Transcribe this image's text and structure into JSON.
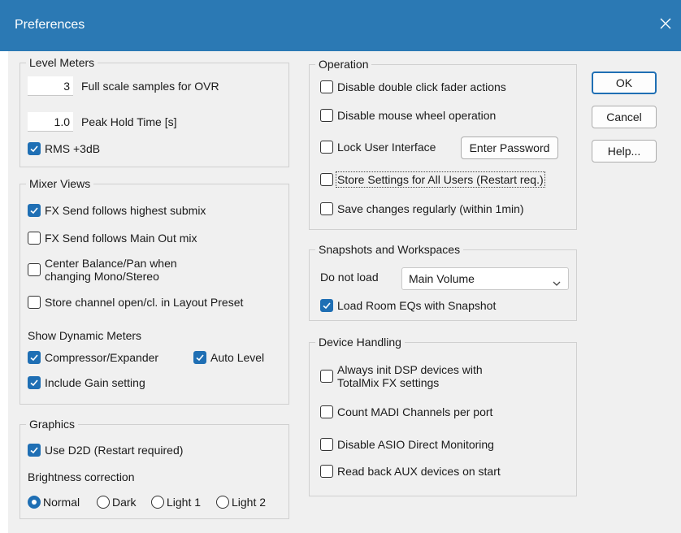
{
  "window": {
    "title": "Preferences",
    "close_icon": "close-icon"
  },
  "level_meters": {
    "legend": "Level Meters",
    "ovr_value": "3",
    "ovr_label": "Full scale samples for OVR",
    "peak_value": "1.0",
    "peak_label": "Peak Hold Time [s]",
    "rms_label": "RMS +3dB"
  },
  "mixer_views": {
    "legend": "Mixer Views",
    "fx_highest": "FX Send follows highest submix",
    "fx_main": "FX Send follows Main Out mix",
    "center_line1": "Center Balance/Pan when",
    "center_line2": "changing Mono/Stereo",
    "store_channel": "Store channel open/cl. in Layout Preset",
    "show_dynamic": "Show Dynamic Meters",
    "compressor": "Compressor/Expander",
    "auto_level": "Auto Level",
    "include_gain": "Include Gain setting"
  },
  "graphics": {
    "legend": "Graphics",
    "use_d2d": "Use D2D (Restart required)",
    "brightness": "Brightness correction",
    "radios": [
      "Normal",
      "Dark",
      "Light 1",
      "Light 2"
    ],
    "selected": "Normal"
  },
  "operation": {
    "legend": "Operation",
    "disable_dblclick": "Disable double click fader actions",
    "disable_wheel": "Disable mouse wheel operation",
    "lock_ui": "Lock User Interface",
    "enter_password": "Enter Password",
    "store_all": "Store Settings for All Users (Restart req.)",
    "save_regularly": "Save changes regularly (within 1min)"
  },
  "snapshots": {
    "legend": "Snapshots and Workspaces",
    "do_not_load": "Do not load",
    "select_value": "Main Volume",
    "load_room": "Load Room EQs with Snapshot"
  },
  "device": {
    "legend": "Device Handling",
    "always_line1": "Always init DSP devices with",
    "always_line2": "TotalMix FX settings",
    "count_madi": "Count MADI Channels per port",
    "disable_asio": "Disable ASIO Direct Monitoring",
    "read_back": "Read back AUX devices on start"
  },
  "buttons": {
    "ok": "OK",
    "cancel": "Cancel",
    "help": "Help..."
  },
  "colors": {
    "titlebar": "#2b79b4",
    "accent": "#1f6fb4",
    "face": "#f0f0f0"
  }
}
